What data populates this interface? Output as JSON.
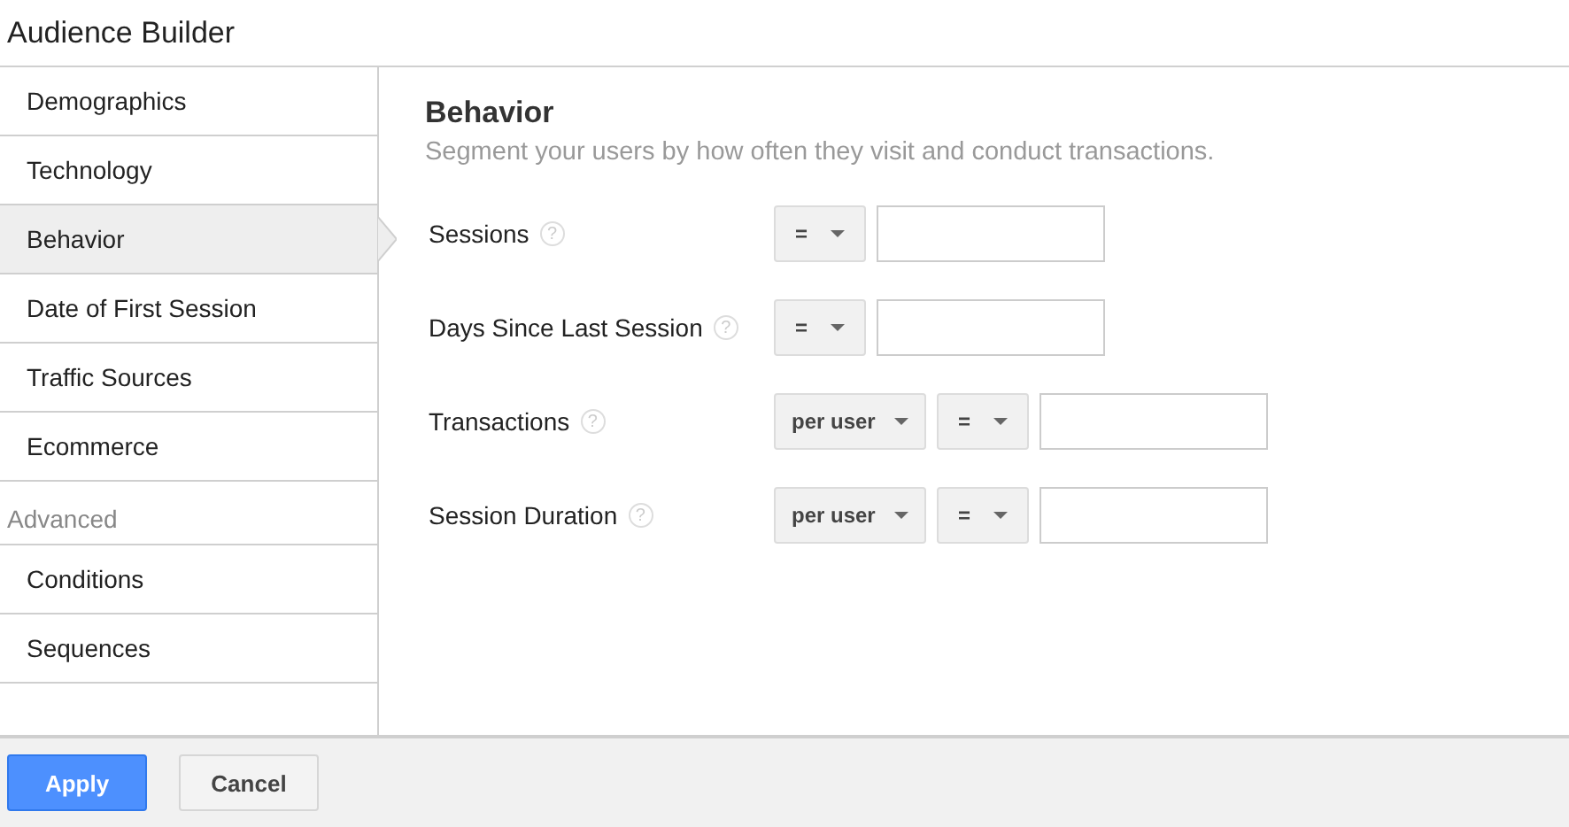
{
  "window": {
    "title": "Audience Builder"
  },
  "sidebar": {
    "sections": [
      {
        "items": [
          {
            "label": "Demographics",
            "selected": false
          },
          {
            "label": "Technology",
            "selected": false
          },
          {
            "label": "Behavior",
            "selected": true
          },
          {
            "label": "Date of First Session",
            "selected": false
          },
          {
            "label": "Traffic Sources",
            "selected": false
          },
          {
            "label": "Ecommerce",
            "selected": false
          }
        ]
      },
      {
        "heading": "Advanced",
        "items": [
          {
            "label": "Conditions",
            "selected": false
          },
          {
            "label": "Sequences",
            "selected": false
          }
        ]
      }
    ]
  },
  "panel": {
    "title": "Behavior",
    "subtitle": "Segment your users by how often they visit and conduct transactions.",
    "rows": [
      {
        "label": "Sessions",
        "help": "?",
        "controls": [
          {
            "kind": "select",
            "value": "="
          },
          {
            "kind": "input"
          }
        ]
      },
      {
        "label": "Days Since Last Session",
        "help": "?",
        "controls": [
          {
            "kind": "select",
            "value": "="
          },
          {
            "kind": "input"
          }
        ]
      },
      {
        "label": "Transactions",
        "help": "?",
        "controls": [
          {
            "kind": "select",
            "value": "per user"
          },
          {
            "kind": "select",
            "value": "="
          },
          {
            "kind": "input"
          }
        ]
      },
      {
        "label": "Session Duration",
        "help": "?",
        "controls": [
          {
            "kind": "select",
            "value": "per user"
          },
          {
            "kind": "select",
            "value": "="
          },
          {
            "kind": "input"
          }
        ]
      }
    ]
  },
  "buttons": [
    {
      "label": "Apply",
      "kind": "primary"
    },
    {
      "label": "Cancel",
      "kind": "secondary"
    }
  ]
}
